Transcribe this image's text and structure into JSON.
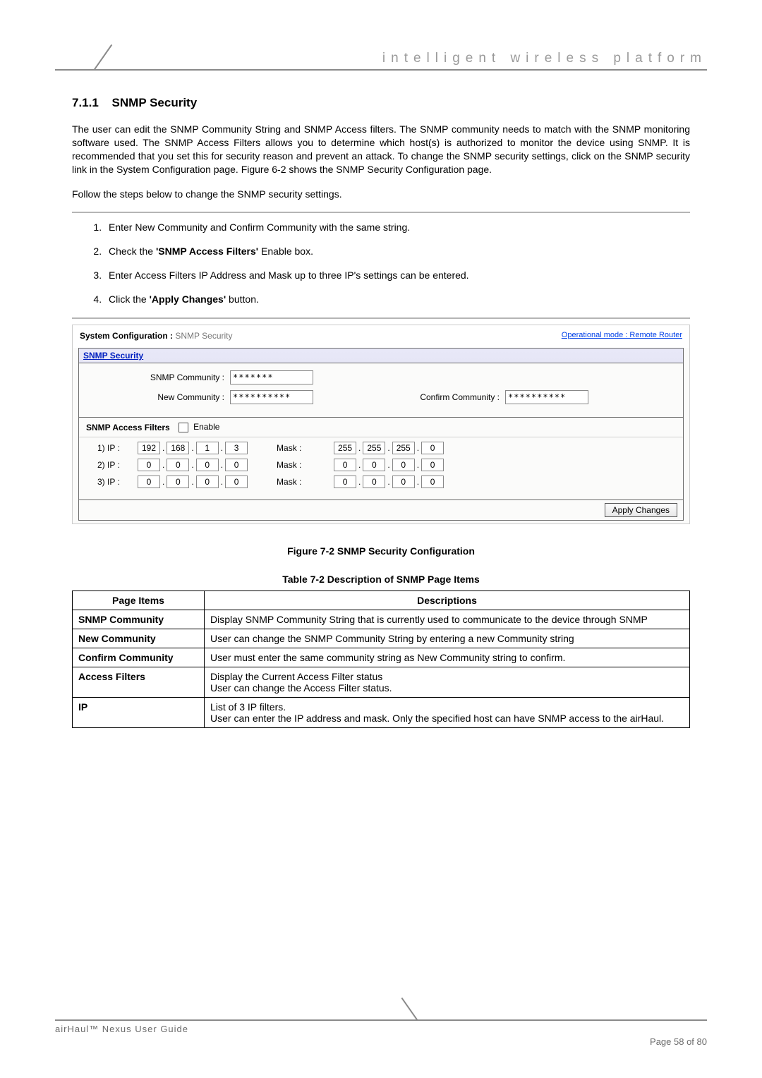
{
  "header": {
    "tagline": "intelligent wireless platform"
  },
  "section": {
    "number": "7.1.1",
    "title": "SNMP Security"
  },
  "para1": "The user can edit the SNMP Community String and SNMP Access filters. The SNMP community needs to match with the SNMP monitoring software used. The SNMP Access Filters allows you to determine which host(s) is authorized to monitor the device using SNMP. It is recommended that you set this for security reason and prevent an attack. To change the SNMP security settings, click on the SNMP security link in the System Configuration page.  Figure 6-2 shows the SNMP Security Configuration page.",
  "para2": "Follow the steps below to change the SNMP security settings.",
  "steps": [
    "Enter New Community and Confirm Community with the same string.",
    "Check the 'SNMP Access Filters' Enable box.",
    "Enter Access Filters IP Address and Mask up to three IP's settings can be entered.",
    "Click the 'Apply Changes' button."
  ],
  "step_bold": {
    "1": "SNMP Access Filters",
    "3": "Apply Changes"
  },
  "panel": {
    "syscfg_label": "System Configuration :",
    "syscfg_page": " SNMP Security",
    "opmode": "Operational mode : Remote Router",
    "box_title": "SNMP Security",
    "snmp_community_label": "SNMP Community :",
    "snmp_community_value": "*******",
    "new_community_label": "New Community :",
    "new_community_value": "**********",
    "confirm_community_label": "Confirm Community :",
    "confirm_community_value": "**********",
    "filters_label": "SNMP Access Filters",
    "enable_label": "Enable",
    "rows": [
      {
        "label": "1) IP :",
        "ip": [
          "192",
          "168",
          "1",
          "3"
        ],
        "masklabel": "Mask :",
        "mask": [
          "255",
          "255",
          "255",
          "0"
        ]
      },
      {
        "label": "2) IP :",
        "ip": [
          "0",
          "0",
          "0",
          "0"
        ],
        "masklabel": "Mask :",
        "mask": [
          "0",
          "0",
          "0",
          "0"
        ]
      },
      {
        "label": "3) IP :",
        "ip": [
          "0",
          "0",
          "0",
          "0"
        ],
        "masklabel": "Mask :",
        "mask": [
          "0",
          "0",
          "0",
          "0"
        ]
      }
    ],
    "apply_label": "Apply Changes"
  },
  "figure_caption": "Figure 7-2 SNMP Security Configuration",
  "table_caption": "Table 7-2 Description of SNMP Page Items",
  "table": {
    "head": {
      "c1": "Page Items",
      "c2": "Descriptions"
    },
    "rows": [
      {
        "item": "SNMP Community",
        "desc": "Display SNMP Community String that is currently used to communicate to the device through SNMP"
      },
      {
        "item": "New  Community",
        "desc": "User can change the SNMP Community String by entering a new Community string"
      },
      {
        "item": "Confirm Community",
        "desc": "User must enter the same community string as New Community string to confirm."
      },
      {
        "item": "Access Filters",
        "desc": "Display the Current Access Filter status\nUser can change the Access Filter status."
      },
      {
        "item": "IP",
        "desc": "List of 3 IP filters.\nUser can enter the IP address and mask. Only the specified host can have SNMP access to the airHaul."
      }
    ]
  },
  "footer": {
    "left": "airHaul™ Nexus User Guide",
    "right": "Page 58 of 80"
  }
}
